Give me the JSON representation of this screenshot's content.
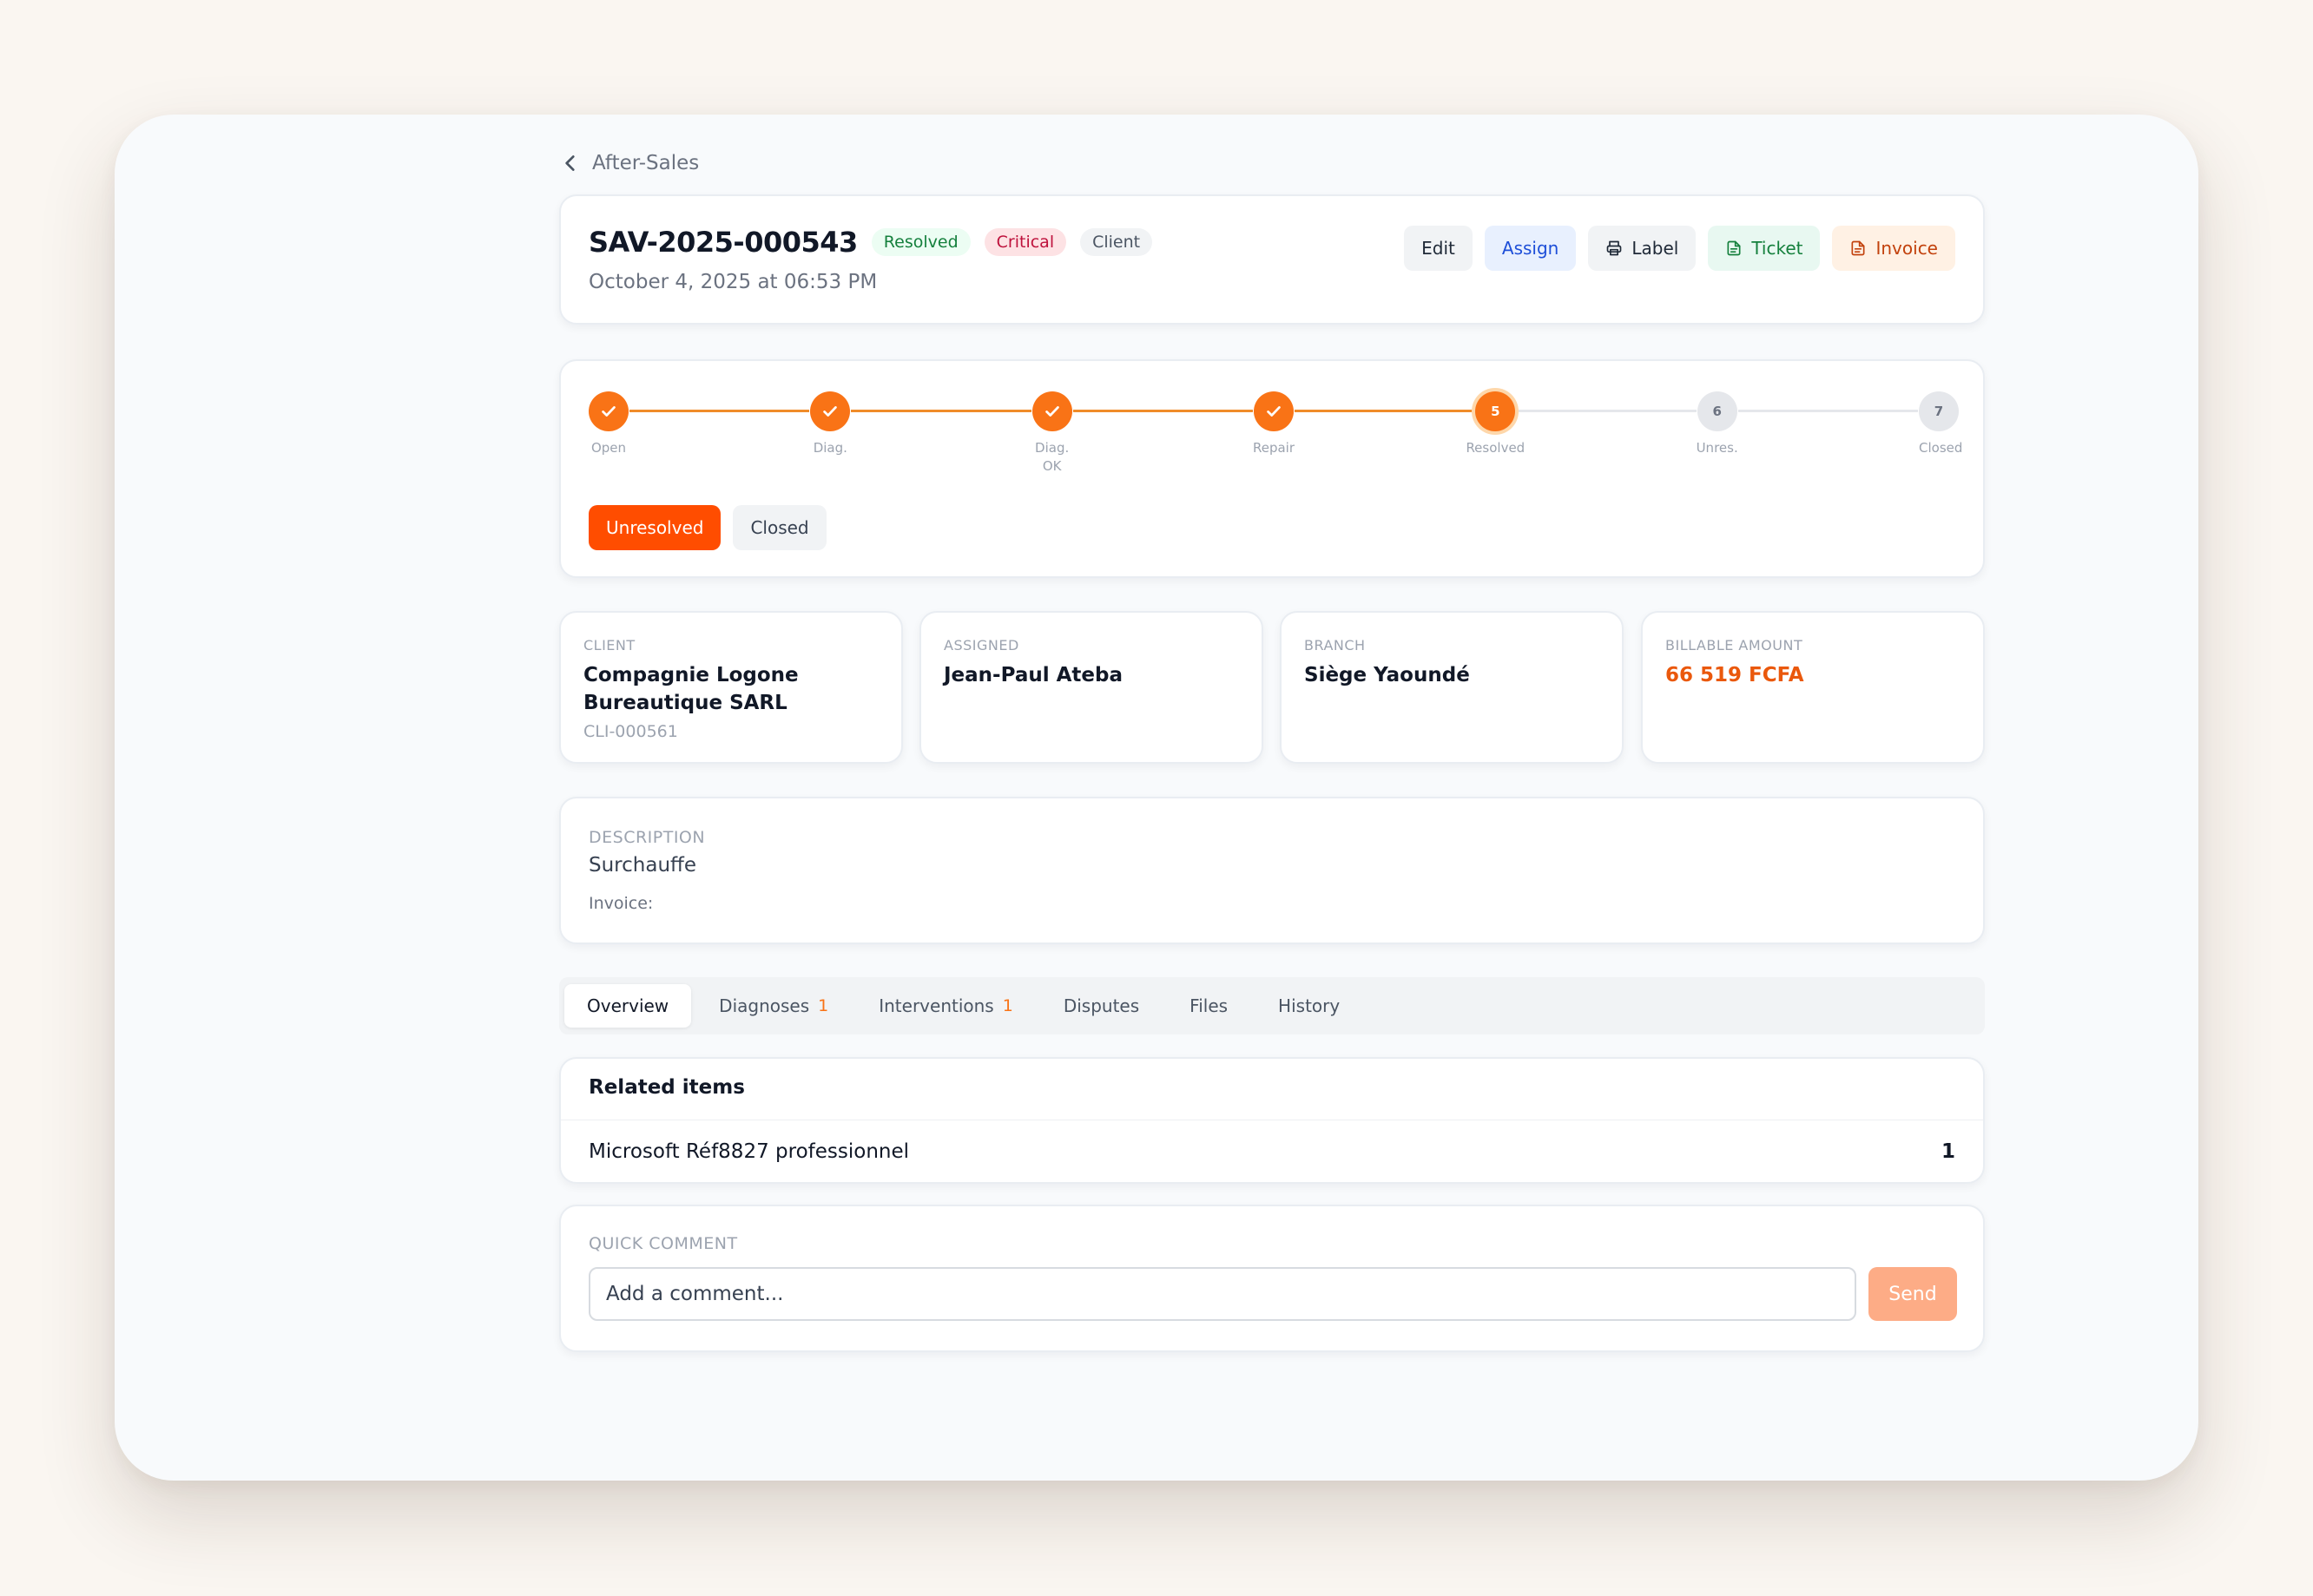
{
  "breadcrumb": {
    "back_label": "After-Sales"
  },
  "header": {
    "code": "SAV-2025-000543",
    "badges": {
      "status": "Resolved",
      "priority": "Critical",
      "origin": "Client"
    },
    "date": "October 4, 2025 at 06:53 PM",
    "actions": {
      "edit": "Edit",
      "assign": "Assign",
      "label": "Label",
      "ticket": "Ticket",
      "invoice": "Invoice"
    }
  },
  "stepper": {
    "steps": [
      {
        "num": "1",
        "label": "Open",
        "state": "done"
      },
      {
        "num": "2",
        "label": "Diag.",
        "state": "done"
      },
      {
        "num": "3",
        "label": "Diag.\nOK",
        "state": "done"
      },
      {
        "num": "4",
        "label": "Repair",
        "state": "done"
      },
      {
        "num": "5",
        "label": "Resolved",
        "state": "current"
      },
      {
        "num": "6",
        "label": "Unres.",
        "state": "todo"
      },
      {
        "num": "7",
        "label": "Closed",
        "state": "todo"
      }
    ],
    "buttons": {
      "unresolved": "Unresolved",
      "closed": "Closed"
    }
  },
  "info": {
    "client": {
      "label": "CLIENT",
      "value": "Compagnie Logone Bureautique SARL",
      "sub": "CLI-000561"
    },
    "assigned": {
      "label": "ASSIGNED",
      "value": "Jean-Paul Ateba"
    },
    "branch": {
      "label": "BRANCH",
      "value": "Siège Yaoundé"
    },
    "billable": {
      "label": "BILLABLE AMOUNT",
      "value": "66 519 FCFA"
    }
  },
  "description": {
    "label": "DESCRIPTION",
    "text": "Surchauffe",
    "invoice_label": "Invoice:"
  },
  "tabs": [
    {
      "label": "Overview",
      "count": ""
    },
    {
      "label": "Diagnoses",
      "count": "1"
    },
    {
      "label": "Interventions",
      "count": "1"
    },
    {
      "label": "Disputes",
      "count": ""
    },
    {
      "label": "Files",
      "count": ""
    },
    {
      "label": "History",
      "count": ""
    }
  ],
  "related": {
    "title": "Related items",
    "items": [
      {
        "name": "Microsoft Réf8827 professionnel",
        "qty": "1"
      }
    ]
  },
  "comment": {
    "label": "QUICK COMMENT",
    "placeholder": "Add a comment...",
    "send": "Send"
  },
  "colors": {
    "accent": "#f97316",
    "danger_button": "#ff4d00",
    "success": "#15803d"
  }
}
